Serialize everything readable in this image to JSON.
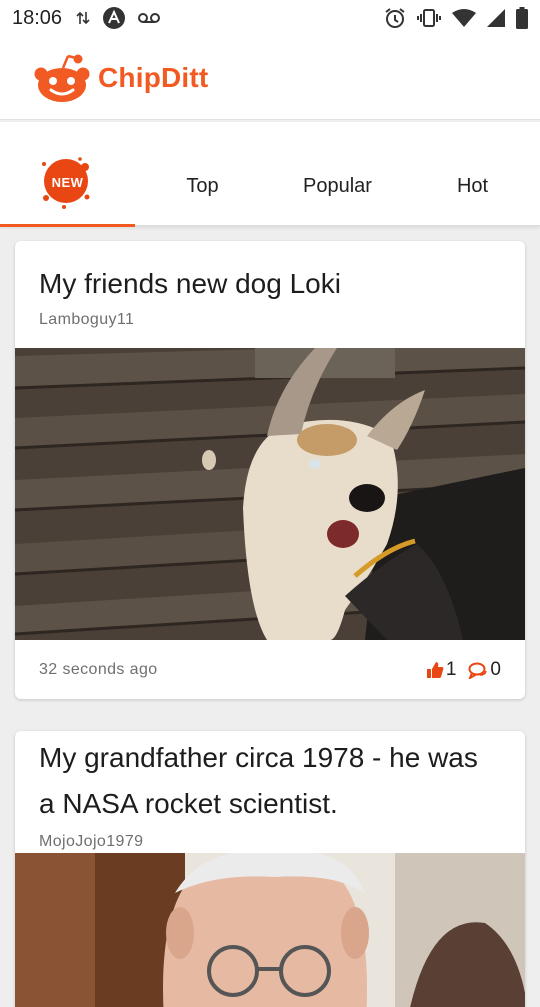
{
  "status_bar": {
    "time": "18:06",
    "icons": [
      "data-transfer-icon",
      "a-letter-icon",
      "voicemail-icon",
      "alarm-icon",
      "vibrate-icon",
      "wifi-icon",
      "signal-icon",
      "battery-icon"
    ]
  },
  "app": {
    "brand": "ChipDitt",
    "brand_color": "#f15a22"
  },
  "tabs": [
    {
      "label": "NEW",
      "active": true
    },
    {
      "label": "Top",
      "active": false
    },
    {
      "label": "Popular",
      "active": false
    },
    {
      "label": "Hot",
      "active": false
    }
  ],
  "posts": [
    {
      "title": "My friends new dog Loki",
      "author": "Lamboguy11",
      "time_ago": "32 seconds ago",
      "likes": "1",
      "comments": "0"
    },
    {
      "title": "My grandfather circa 1978 - he was a NASA rocket scientist.",
      "author": "MojoJojo1979"
    }
  ]
}
